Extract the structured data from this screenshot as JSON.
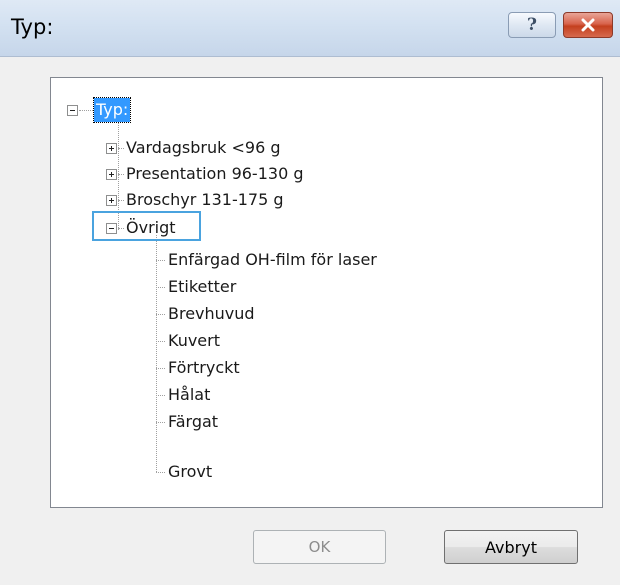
{
  "window": {
    "title": "Typ:",
    "help_label": "?",
    "close_label": "×"
  },
  "tree": {
    "root": {
      "label": "Typ:",
      "expanded": true,
      "selected": true
    },
    "groups": [
      {
        "label": "Vardagsbruk <96 g",
        "expanded": false
      },
      {
        "label": "Presentation 96-130 g",
        "expanded": false
      },
      {
        "label": "Broschyr 131-175 g",
        "expanded": false
      },
      {
        "label": "Övrigt",
        "expanded": true,
        "focused": true
      }
    ],
    "ovrigt_children": [
      "Enfärgad OH-film för laser",
      "Etiketter",
      "Brevhuvud",
      "Kuvert",
      "Förtryckt",
      "Hålat",
      "Färgat",
      "Grovt"
    ]
  },
  "buttons": {
    "ok_label": "OK",
    "ok_enabled": false,
    "cancel_label": "Avbryt"
  },
  "colors": {
    "selection": "#3399ff",
    "focus_border": "#4aa3df",
    "close_button": "#c4401f"
  }
}
